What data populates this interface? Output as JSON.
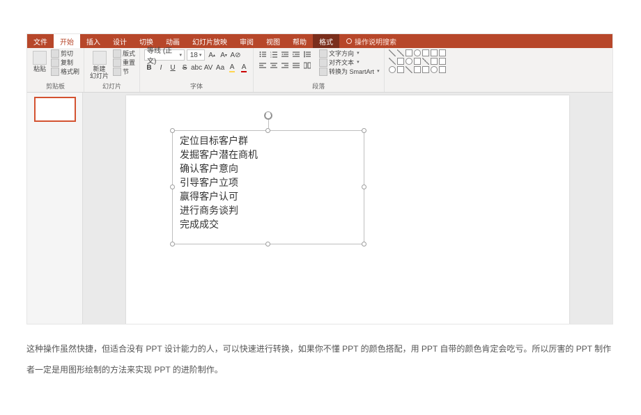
{
  "ribbon": {
    "tabs": {
      "file": "文件",
      "home": "开始",
      "insert": "插入",
      "design": "设计",
      "transitions": "切换",
      "animations": "动画",
      "slideshow": "幻灯片放映",
      "review": "审阅",
      "view": "视图",
      "help": "帮助",
      "format": "格式"
    },
    "tell_me": "操作说明搜索",
    "clipboard": {
      "paste": "粘贴",
      "cut": "剪切",
      "copy": "复制",
      "format_painter": "格式刷",
      "group_label": "剪贴板"
    },
    "slides": {
      "new_slide": "新建\n幻灯片",
      "layout": "版式",
      "reset": "重置",
      "section": "节",
      "group_label": "幻灯片"
    },
    "font": {
      "name": "等线 (正文)",
      "size": "18",
      "group_label": "字体"
    },
    "paragraph": {
      "text_direction": "文字方向",
      "align_text": "对齐文本",
      "smartart": "转换为 SmartArt",
      "group_label": "段落"
    }
  },
  "textbox_lines": {
    "l1": "定位目标客户群",
    "l2": "发掘客户潜在商机",
    "l3": "确认客户意向",
    "l4": "引导客户立项",
    "l5": "赢得客户认可",
    "l6": "进行商务谈判",
    "l7": "完成成交"
  },
  "article": {
    "text": "这种操作虽然快捷，但适合没有 PPT 设计能力的人，可以快速进行转换，如果你不懂 PPT 的颜色搭配，用 PPT 自带的颜色肯定会吃亏。所以厉害的 PPT 制作者一定是用图形绘制的方法来实现 PPT 的进阶制作。"
  }
}
